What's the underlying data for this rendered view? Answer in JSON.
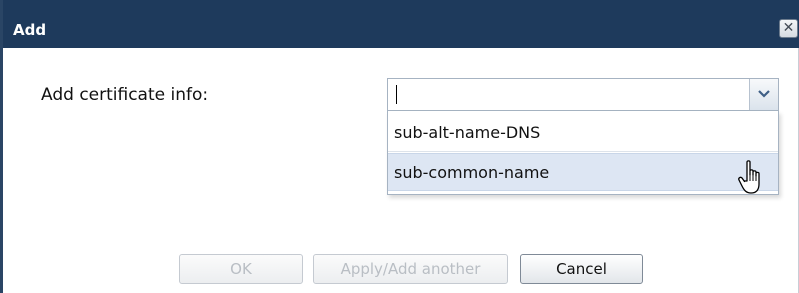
{
  "dialog": {
    "title": "Add",
    "close_glyph": "✕",
    "colors": {
      "titlebar": "#1e3a5c",
      "hover_row": "#dde6f3"
    }
  },
  "form": {
    "label": "Add certificate info:",
    "combo_value": "",
    "dropdown_options": [
      "sub-alt-name-DNS",
      "sub-common-name"
    ]
  },
  "buttons": {
    "ok": "OK",
    "apply": "Apply/Add another",
    "cancel": "Cancel"
  },
  "icons": [
    "close-icon",
    "chevron-down-icon",
    "hand-pointer-cursor-icon"
  ]
}
